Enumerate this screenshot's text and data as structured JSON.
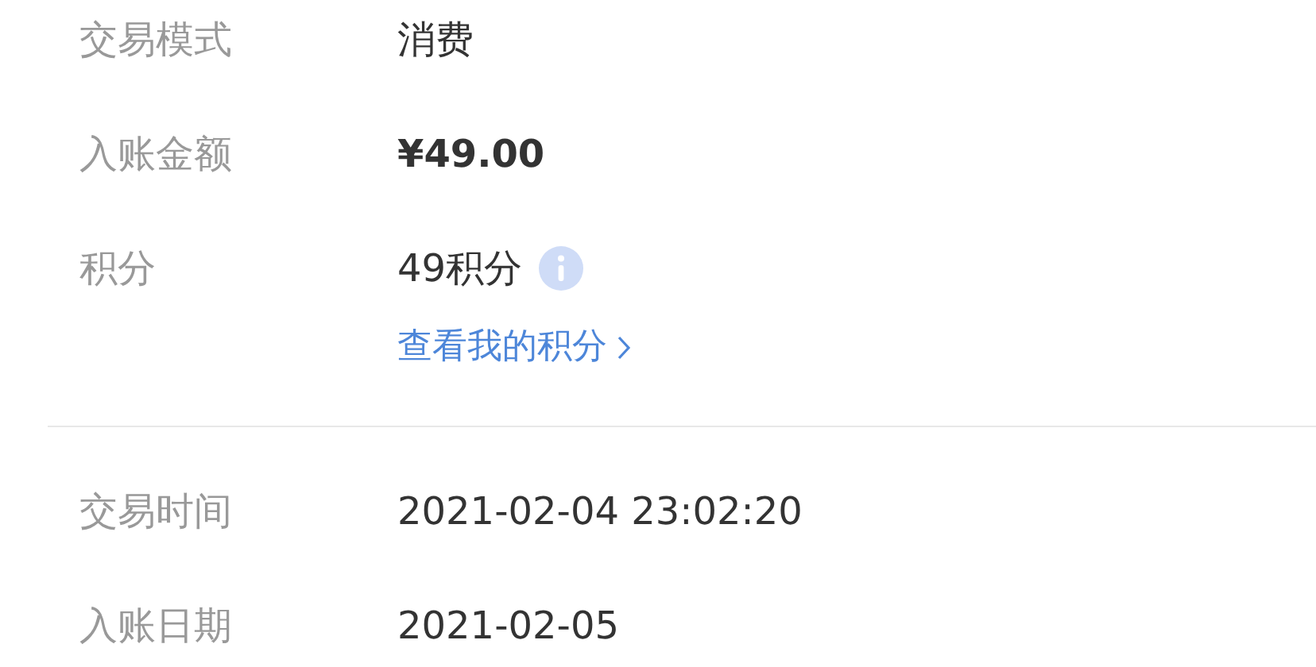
{
  "sections": [
    {
      "rows": [
        {
          "kind": "plain",
          "label": "交易模式",
          "value": "消费"
        },
        {
          "kind": "amount",
          "label": "入账金额",
          "value": "¥49.00"
        },
        {
          "kind": "points",
          "label": "积分",
          "value": "49积分",
          "link": "查看我的积分"
        }
      ]
    },
    {
      "rows": [
        {
          "kind": "plain",
          "label": "交易时间",
          "value": "2021-02-04 23:02:20"
        },
        {
          "kind": "plain",
          "label": "入账日期",
          "value": "2021-02-05"
        }
      ]
    }
  ]
}
